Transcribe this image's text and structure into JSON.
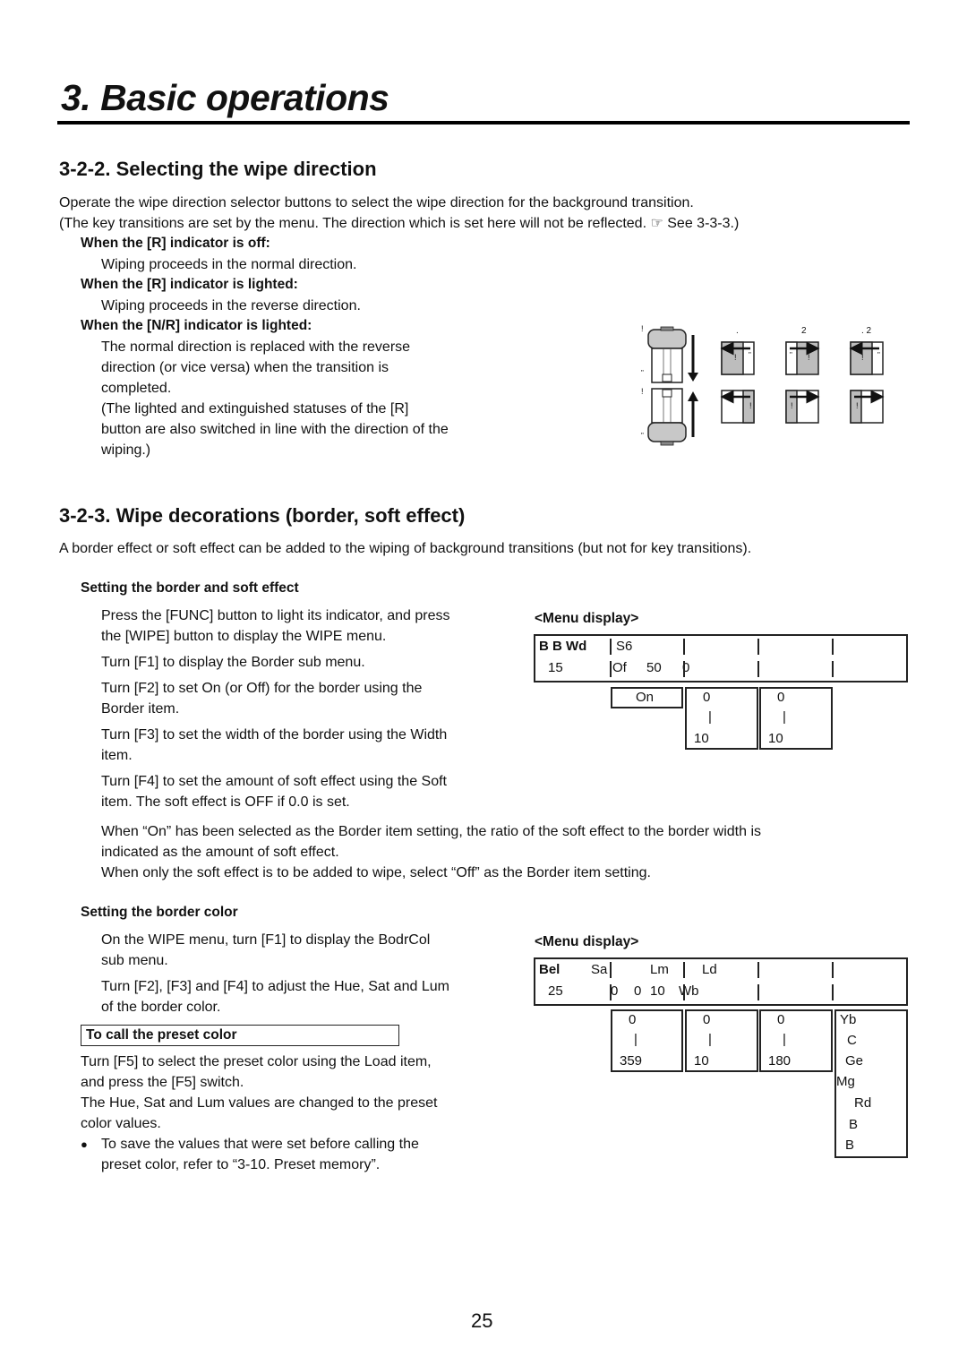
{
  "chapter_title": "3. Basic operations",
  "section_322": {
    "title": "3-2-2. Selecting the wipe direction",
    "intro_1": "Operate the wipe direction selector buttons to select the wipe direction for the background transition.",
    "intro_2": "(The key transitions are set by the menu. The direction which is set here will not be reflected. ☞ See 3-3-3.)",
    "cases": [
      {
        "heading": "When the [R] indicator is off:",
        "lines": [
          "Wiping proceeds in the normal direction."
        ]
      },
      {
        "heading": "When the [R] indicator is lighted:",
        "lines": [
          "Wiping proceeds in the reverse direction."
        ]
      },
      {
        "heading": "When the [N/R] indicator is lighted:",
        "lines": [
          "The normal direction is replaced with the reverse",
          "direction (or vice versa) when the transition is",
          "completed.",
          "(The lighted and extinguished statuses of the [R]",
          "button are also switched in line with the direction of the",
          "wiping.)"
        ]
      }
    ],
    "diagram": {
      "fader_marks": {
        "top_upper": "!",
        "top_lower": "\"",
        "bottom_upper": "!",
        "bottom_lower": "\""
      },
      "column_labels": [
        ".",
        "2",
        ". 2"
      ],
      "box_marks": {
        "a": "!",
        "b": "\""
      }
    }
  },
  "section_323": {
    "title": "3-2-3. Wipe decorations (border, soft effect)",
    "intro": "A border effect or soft effect can be added to the wiping of background transitions (but not for key transitions).",
    "border_soft": {
      "heading": "Setting the border and soft effect",
      "steps": [
        [
          "Press the [FUNC] button to light its indicator, and press",
          "the [WIPE] button to display the WIPE menu."
        ],
        [
          "Turn [F1] to display the Border sub menu."
        ],
        [
          "Turn [F2] to set On (or Off) for the border using the",
          "Border item."
        ],
        [
          "Turn [F3] to set the width of the border using the Width",
          "item."
        ],
        [
          "Turn [F4] to set the amount of soft effect using the Soft",
          "item. The soft effect is OFF if 0.0 is set."
        ]
      ],
      "note_lines": [
        "When “On” has been selected as the Border item setting, the ratio of the soft effect to the border width is",
        "indicated as the amount of soft effect.",
        "When only the soft effect is to be added to wipe, select “Off” as the Border item setting."
      ],
      "menu": {
        "title": "<Menu display>",
        "row1": {
          "c1": "B B Wd",
          "c2": "S6"
        },
        "row2": {
          "c1": "15",
          "c2a": "Of",
          "c2b": "50",
          "c3": "0"
        },
        "options": [
          {
            "lines": [
              "On"
            ]
          },
          {
            "lines": [
              "0",
              "|",
              "10"
            ]
          },
          {
            "lines": [
              "0",
              "|",
              "10"
            ]
          }
        ]
      }
    },
    "border_color": {
      "heading": "Setting the border color",
      "steps": [
        [
          "On the WIPE menu, turn [F1] to display the BodrCol",
          "sub menu."
        ],
        [
          "Turn [F2], [F3] and [F4] to adjust the Hue, Sat and Lum",
          "of the border color."
        ]
      ],
      "preset_box_label": "To call the preset color",
      "preset_lines": [
        "Turn [F5] to select the preset color using the Load item,",
        "and press the [F5] switch.",
        "The Hue, Sat and Lum values are changed to the preset",
        "color values."
      ],
      "bullet_lines": [
        "To save the values that were set before calling the",
        "preset color, refer to “3-10. Preset memory”."
      ],
      "bullet_glyph": "●",
      "menu": {
        "title": "<Menu display>",
        "row1": {
          "c1a": "Bel",
          "c1b": "Sa",
          "c2": "Lm",
          "c3": "Ld"
        },
        "row2": {
          "c1": "25",
          "c2a": "0",
          "c2b": "0",
          "c2c": "10",
          "c3": "Wb"
        },
        "options": [
          {
            "lines": [
              "0",
              "|",
              "359"
            ]
          },
          {
            "lines": [
              "0",
              "|",
              "10"
            ]
          },
          {
            "lines": [
              "0",
              "|",
              "180"
            ]
          }
        ],
        "preset_list": [
          "Yb",
          "C",
          "Ge",
          "Mg",
          "Rd",
          "B",
          "B"
        ]
      }
    }
  },
  "page_number": "25"
}
